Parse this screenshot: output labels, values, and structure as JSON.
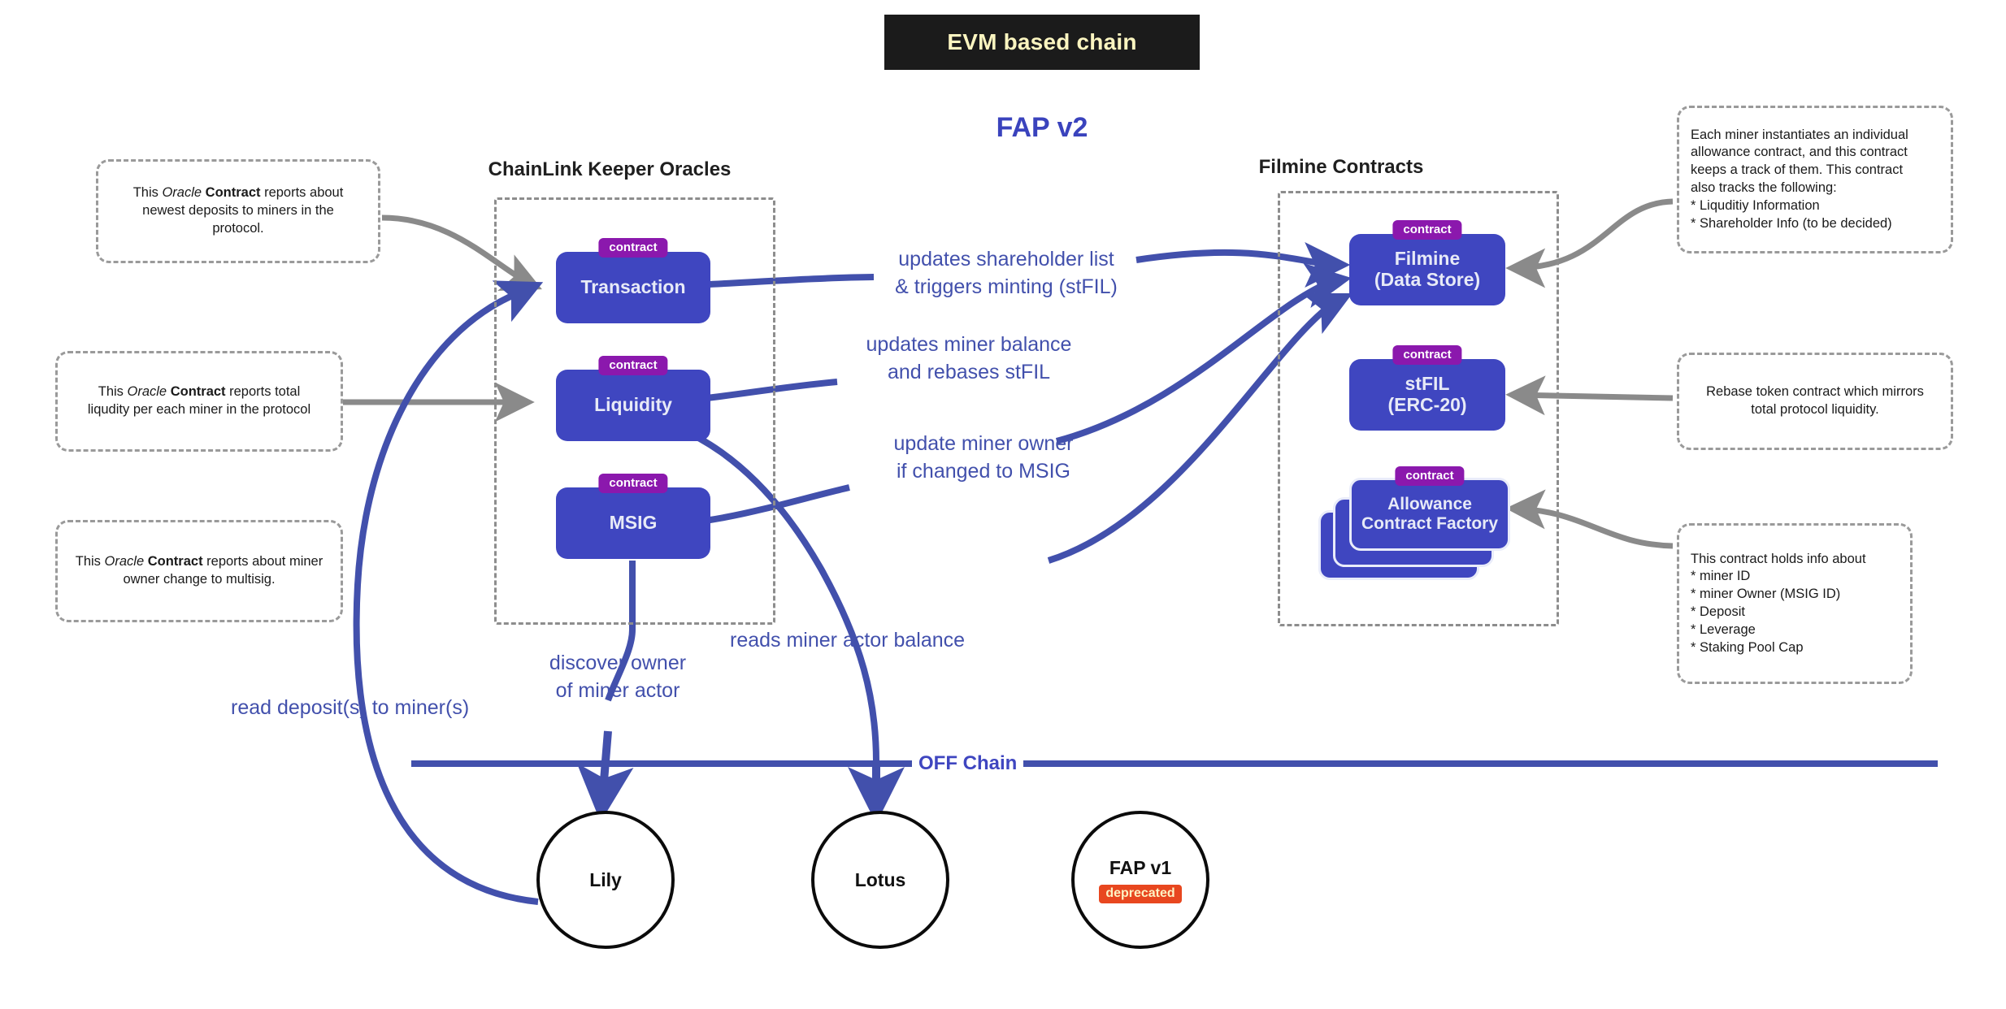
{
  "header": {
    "banner_label": "EVM based chain",
    "diagram_title": "FAP v2",
    "banner_bg": "#1b1b1b",
    "banner_fg": "#fbf5c0",
    "title_color": "#3a43bd"
  },
  "colors": {
    "node_blue": "#3f46c0",
    "badge_purple": "#8b18ad",
    "edge_blue": "#4250ac",
    "edge_gray": "#8a8a8a",
    "deprecated_red": "#e8471f"
  },
  "groups": [
    {
      "title": "ChainLink Keeper Oracles"
    },
    {
      "title": "Filmine Contracts"
    }
  ],
  "nodes": {
    "transaction": {
      "badge": "contract",
      "label": "Transaction"
    },
    "liquidity": {
      "badge": "contract",
      "label": "Liquidity"
    },
    "msig": {
      "badge": "contract",
      "label": "MSIG"
    },
    "filmine": {
      "badge": "contract",
      "label_line1": "Filmine",
      "label_line2": "(Data Store)"
    },
    "stfil": {
      "badge": "contract",
      "label_line1": "stFIL",
      "label_line2": "(ERC-20)"
    },
    "allowance": {
      "badge": "contract",
      "label_line1": "Allowance",
      "label_line2": "Contract Factory"
    }
  },
  "notes": {
    "deposits": {
      "line1_a": "This ",
      "line1_em": "Oracle",
      "line1_b": " ",
      "line1_strong": "Contract",
      "line1_c": " reports about",
      "line2": "newest deposits to miners in the",
      "line3": "protocol."
    },
    "liquidity": {
      "line1_a": "This ",
      "line1_em": "Oracle",
      "line1_b": " ",
      "line1_strong": "Contract",
      "line1_c": " reports total",
      "line2": "liqudity per each miner in the protocol"
    },
    "multisig": {
      "line1_a": "This ",
      "line1_em": "Oracle",
      "line1_b": " ",
      "line1_strong": "Contract",
      "line1_c": " reports about miner",
      "line2": "owner change to multisig."
    },
    "allowance_factory": {
      "lines": [
        "Each miner instantiates an individual",
        "allowance contract, and this contract",
        "keeps a track of them. This contract",
        "also tracks the following:",
        "* Liquditiy Information",
        "* Shareholder Info (to be decided)"
      ]
    },
    "rebase": {
      "lines": [
        "Rebase token contract which mirrors",
        "total protocol liquidity."
      ]
    },
    "allowance_contract": {
      "lines": [
        "This contract holds info about",
        "*  miner ID",
        "*  miner Owner (MSIG ID)",
        "*  Deposit",
        "*  Leverage",
        "*  Staking Pool Cap"
      ]
    }
  },
  "edge_labels": {
    "shareholder": {
      "line1": "updates shareholder list",
      "line2": "& triggers minting (stFIL)"
    },
    "miner_balance": {
      "line1": "updates miner balance",
      "line2": "and rebases stFIL"
    },
    "miner_owner": {
      "line1": "update miner owner",
      "line2": "if changed to MSIG"
    },
    "reads_balance": "reads miner actor balance",
    "discover_owner": {
      "line1": "discover owner",
      "line2": "of miner actor"
    },
    "read_deposits": "read deposit(s) to miner(s)"
  },
  "divider": {
    "label": "OFF Chain"
  },
  "offchain_nodes": [
    {
      "label": "Lily",
      "badge": ""
    },
    {
      "label": "Lotus",
      "badge": ""
    },
    {
      "label": "FAP v1",
      "badge": "deprecated"
    }
  ]
}
